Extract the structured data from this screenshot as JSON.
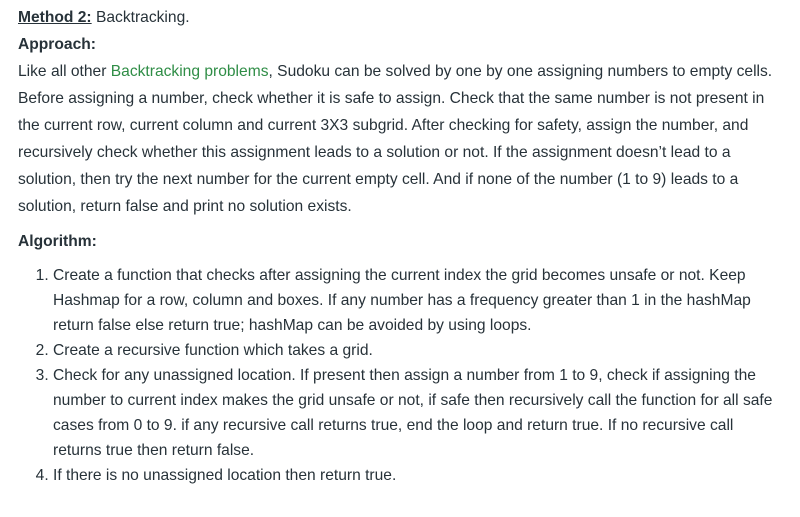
{
  "method": {
    "label": "Method 2:",
    "name": " Backtracking."
  },
  "approach": {
    "heading": "Approach:",
    "text_before_link": "Like all other ",
    "link_text": "Backtracking problems",
    "text_after_link": ", Sudoku can be solved by one by one assigning numbers to empty cells. Before assigning a number, check whether it is safe to assign. Check that the same number is not present in the current row, current column and current 3X3 subgrid. After checking for safety, assign the number, and recursively check whether this assignment leads to a solution or not. If the assignment doesn’t lead to a solution, then try the next number for the current empty cell. And if none of the number (1 to 9) leads to a solution, return false and print no solution exists.",
    "link_color": "#2f8d46"
  },
  "algorithm": {
    "heading": "Algorithm:",
    "steps": [
      "Create a function that checks after assigning the current index the grid becomes unsafe or not. Keep Hashmap for a row, column and boxes. If any number has a frequency greater than 1 in the hashMap return false else return true; hashMap can be avoided by using loops.",
      "Create a recursive function which takes a grid.",
      "Check for any unassigned location. If present then assign a number from 1 to 9, check if assigning the number to current index makes the grid unsafe or not, if safe then recursively call the function for all safe cases from 0 to 9. if any recursive call returns true, end the loop and return true. If no recursive call returns true then return false.",
      "If there is no unassigned location then return true."
    ]
  }
}
